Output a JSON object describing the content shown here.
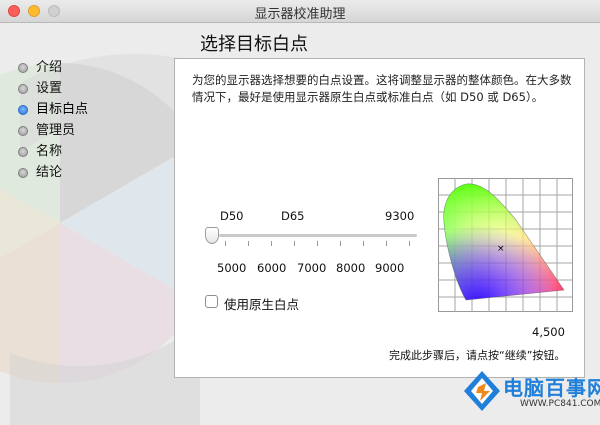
{
  "window": {
    "title": "显示器校准助理"
  },
  "sidebar": {
    "items": [
      {
        "label": "介绍",
        "active": false
      },
      {
        "label": "设置",
        "active": false
      },
      {
        "label": "目标白点",
        "active": true
      },
      {
        "label": "管理员",
        "active": false
      },
      {
        "label": "名称",
        "active": false
      },
      {
        "label": "结论",
        "active": false
      }
    ]
  },
  "page": {
    "title": "选择目标白点",
    "description": "为您的显示器选择想要的白点设置。这将调整显示器的整体颜色。在大多数情况下，最好是使用显示器原生白点或标准白点（如 D50 或 D65）。"
  },
  "slider": {
    "top_labels": [
      "D50",
      "D65",
      "9300"
    ],
    "scale_labels": [
      "5000",
      "6000",
      "7000",
      "8000",
      "9000"
    ],
    "value": 5000
  },
  "native_checkbox": {
    "label": "使用原生白点",
    "checked": false
  },
  "gamut": {
    "value_label": "4,500"
  },
  "footer": {
    "text": "完成此步骤后，请点按“继续”按钮。"
  },
  "watermark": {
    "brand": "电脑百事网",
    "url": "WWW.PC841.COM"
  }
}
